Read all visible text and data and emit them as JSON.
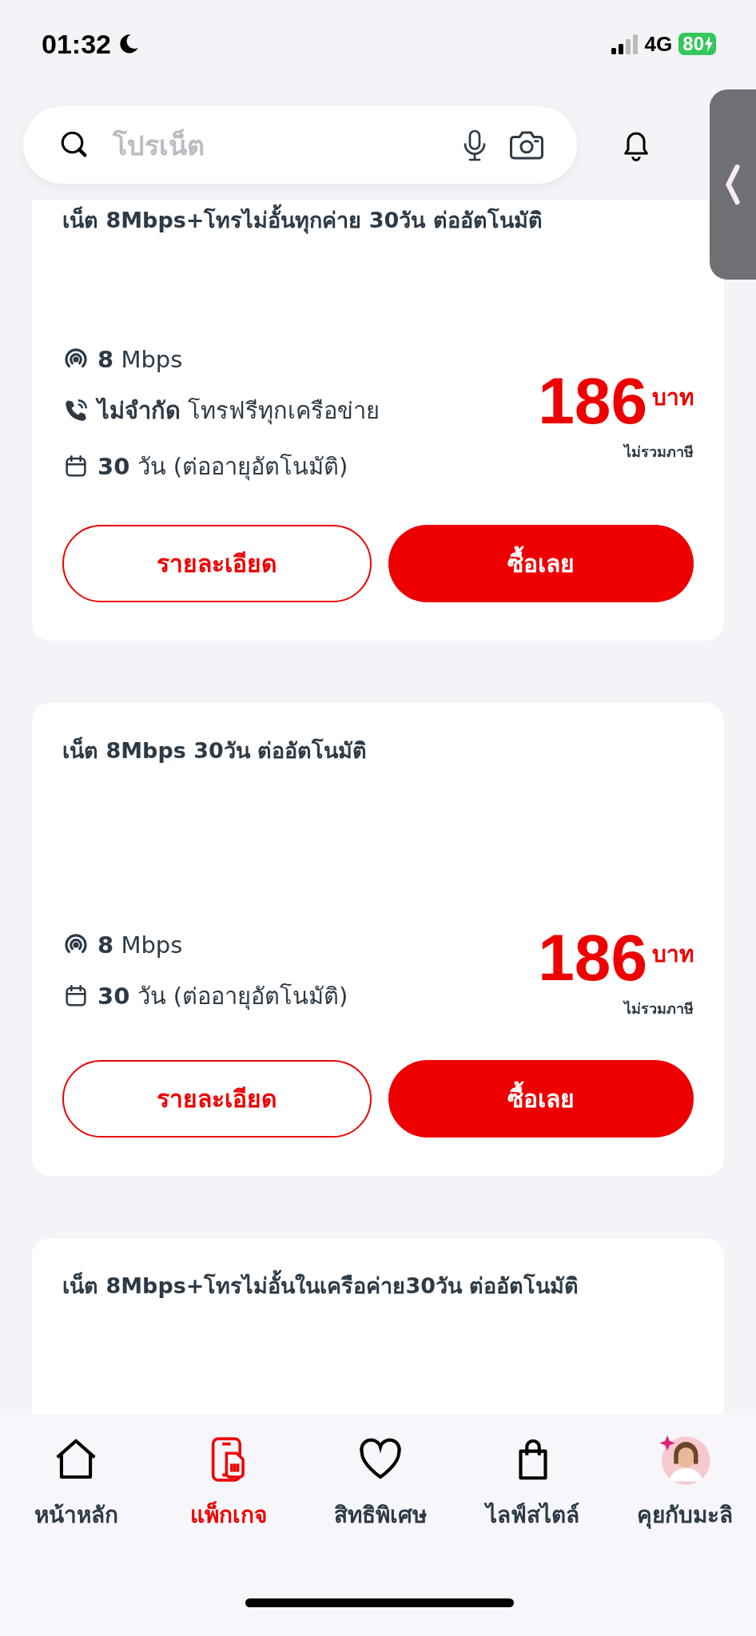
{
  "status_bar": {
    "time": "01:32",
    "network": "4G",
    "battery": "80"
  },
  "search": {
    "placeholder": "โปรเน็ต"
  },
  "packages": [
    {
      "title": "เน็ต 8Mbps+โทรไม่อั้นทุกค่าย 30วัน ต่ออัตโนมัติ",
      "features": [
        {
          "kind": "speed",
          "value": "8",
          "text": "Mbps"
        },
        {
          "kind": "call",
          "value": "ไม่จำกัด",
          "text": "โทรฟรีทุกเครือข่าย"
        },
        {
          "kind": "days",
          "value": "30",
          "text": "วัน (ต่ออายุอัตโนมัติ)"
        }
      ],
      "price": "186",
      "currency": "บาท",
      "tax_note": "ไม่รวมภาษี",
      "detail_button": "รายละเอียด",
      "buy_button": "ซื้อเลย"
    },
    {
      "title": "เน็ต 8Mbps 30วัน ต่ออัตโนมัติ",
      "features": [
        {
          "kind": "speed",
          "value": "8",
          "text": "Mbps"
        },
        {
          "kind": "days",
          "value": "30",
          "text": "วัน (ต่ออายุอัตโนมัติ)"
        }
      ],
      "price": "186",
      "currency": "บาท",
      "tax_note": "ไม่รวมภาษี",
      "detail_button": "รายละเอียด",
      "buy_button": "ซื้อเลย"
    },
    {
      "title": "เน็ต 8Mbps+โทรไม่อั้นในเครือค่าย30วัน ต่ออัตโนมัติ"
    }
  ],
  "bottom_nav": [
    {
      "kind": "home",
      "label": "หน้าหลัก",
      "selected": false
    },
    {
      "kind": "package",
      "label": "แพ็กเกจ",
      "selected": true
    },
    {
      "kind": "privilege",
      "label": "สิทธิพิเศษ",
      "selected": false
    },
    {
      "kind": "lifestyle",
      "label": "ไลฟ์สไตล์",
      "selected": false
    },
    {
      "kind": "assistant",
      "label": "คุยกับมะลิ",
      "selected": false
    }
  ]
}
